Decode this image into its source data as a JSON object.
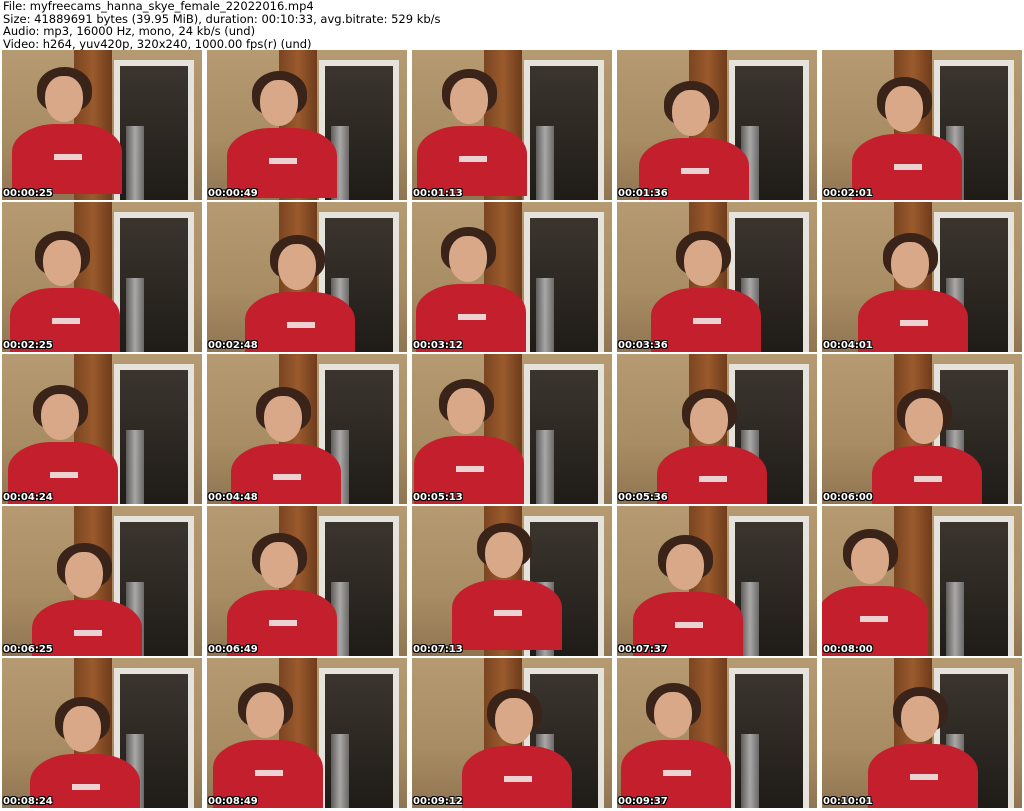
{
  "header": {
    "file": "File: myfreecams_hanna_skye_female_22022016.mp4",
    "size": "Size: 41889691 bytes (39.95 MiB), duration: 00:10:33, avg.bitrate: 529 kb/s",
    "audio": "Audio: mp3, 16000 Hz, mono, 24 kb/s (und)",
    "video": "Video: h264, yuv420p, 320x240, 1000.00 fps(r) (und)"
  },
  "thumbnails": [
    {
      "time": "00:00:25"
    },
    {
      "time": "00:00:49"
    },
    {
      "time": "00:01:13"
    },
    {
      "time": "00:01:36"
    },
    {
      "time": "00:02:01"
    },
    {
      "time": "00:02:25"
    },
    {
      "time": "00:02:48"
    },
    {
      "time": "00:03:12"
    },
    {
      "time": "00:03:36"
    },
    {
      "time": "00:04:01"
    },
    {
      "time": "00:04:24"
    },
    {
      "time": "00:04:48"
    },
    {
      "time": "00:05:13"
    },
    {
      "time": "00:05:36"
    },
    {
      "time": "00:06:00"
    },
    {
      "time": "00:06:25"
    },
    {
      "time": "00:06:49"
    },
    {
      "time": "00:07:13"
    },
    {
      "time": "00:07:37"
    },
    {
      "time": "00:08:00"
    },
    {
      "time": "00:08:24"
    },
    {
      "time": "00:08:49"
    },
    {
      "time": "00:09:12"
    },
    {
      "time": "00:09:37"
    },
    {
      "time": "00:10:01"
    }
  ]
}
